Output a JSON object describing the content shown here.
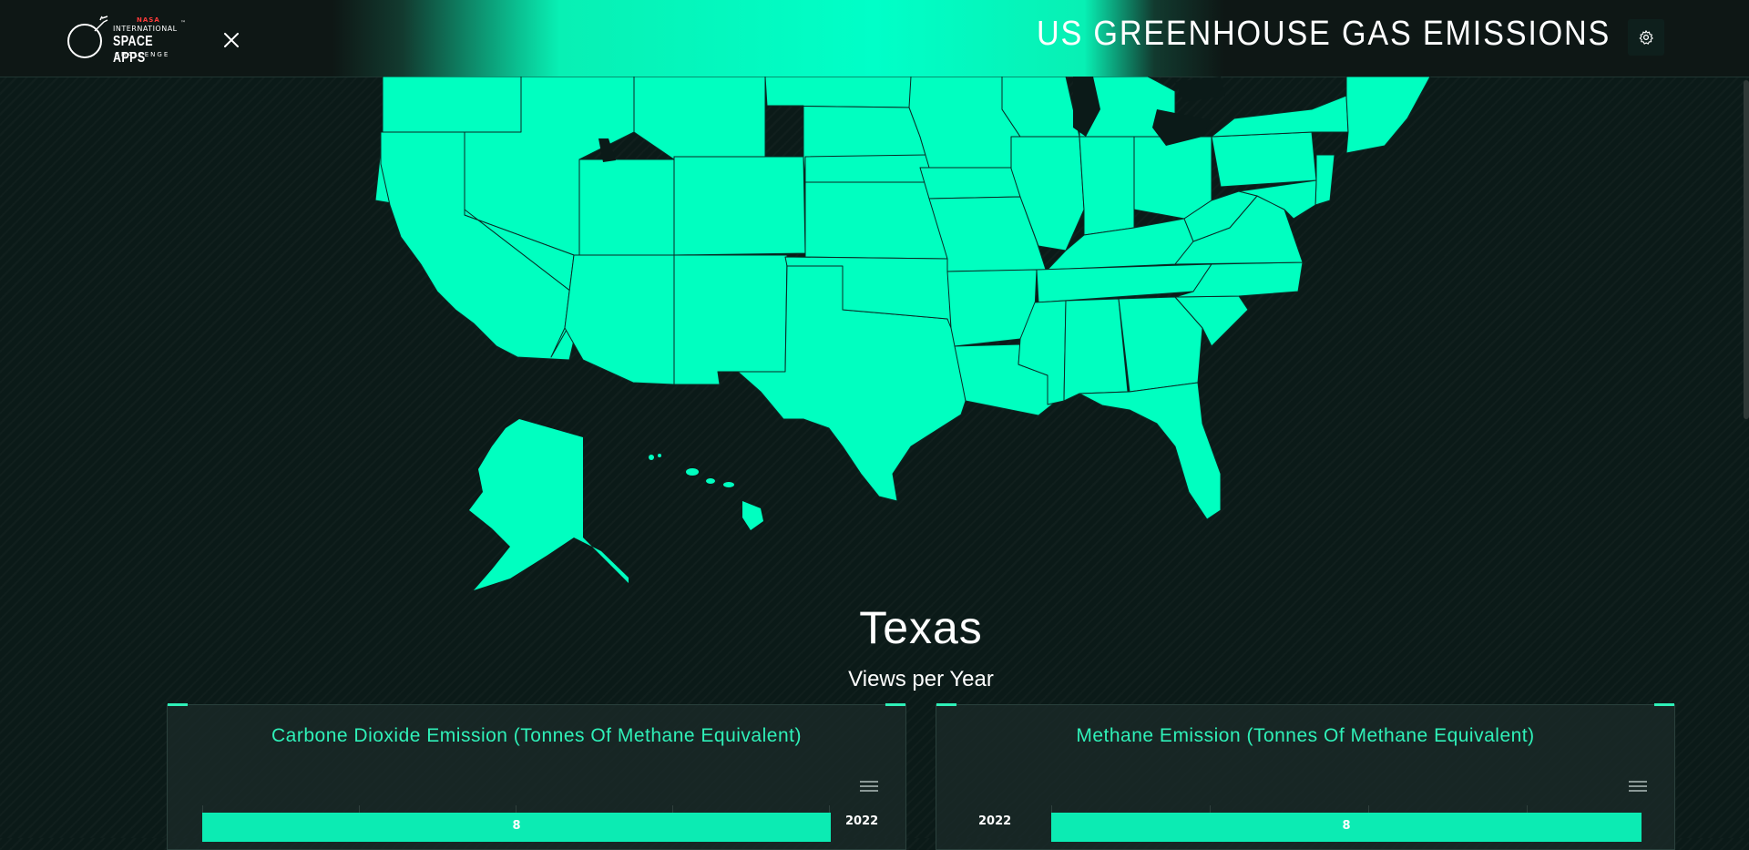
{
  "header": {
    "logo": {
      "nasa": "NASA",
      "line1": "INTERNATIONAL",
      "line2": "SPACE APPS",
      "line3": "CHALLENGE",
      "tm": "™"
    },
    "title": "US GREENHOUSE GAS EMISSIONS",
    "close_icon": "close-icon",
    "settings_icon": "gear-icon"
  },
  "map": {
    "fill_color": "#00ffc0",
    "border_color": "#0a2a24"
  },
  "selection": {
    "state": "Texas",
    "subtitle": "Views per Year"
  },
  "cards": [
    {
      "title": "Carbone Dioxide Emission (Tonnes Of Methane Equivalent)",
      "menu_icon": "hamburger-menu-icon",
      "chart_data": {
        "type": "bar",
        "orientation": "horizontal",
        "categories": [
          "2022"
        ],
        "values": [
          8
        ],
        "data_labels": [
          "8"
        ],
        "category_axis": "right",
        "color": "#0cebb3"
      }
    },
    {
      "title": "Methane Emission (Tonnes Of Methane Equivalent)",
      "menu_icon": "hamburger-menu-icon",
      "chart_data": {
        "type": "bar",
        "orientation": "horizontal",
        "categories": [
          "2022"
        ],
        "values": [
          8
        ],
        "data_labels": [
          "8"
        ],
        "category_axis": "left",
        "color": "#0cebb3"
      }
    }
  ]
}
